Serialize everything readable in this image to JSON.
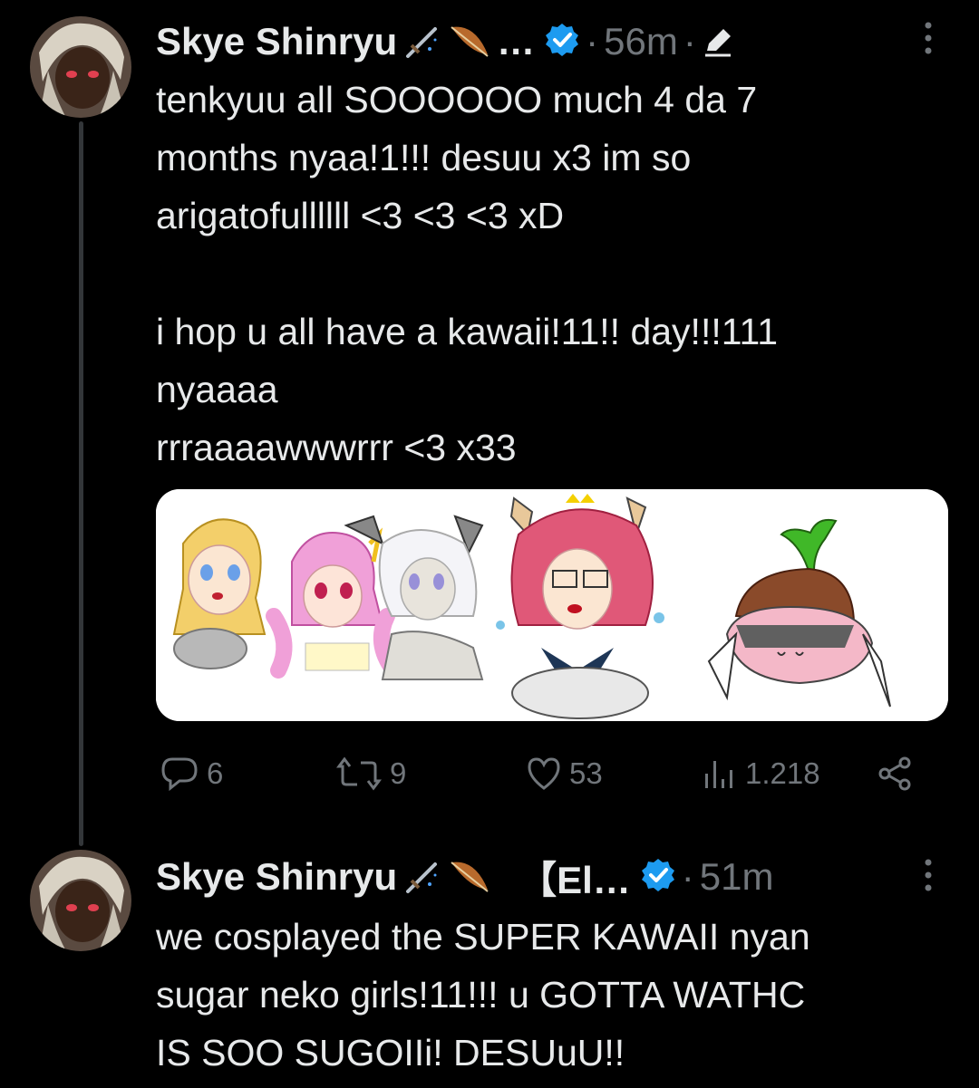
{
  "tweets": [
    {
      "author": "Skye Shinryu",
      "name_suffix": "…",
      "time": "56m",
      "body": "tenkyuu all SOOOOOO much 4 da 7\nmonths nyaa!1!!! desuu x3 im so\narigatofullllll <3 <3 <3 xD\n\ni hop u all have a kawaii!11!! day!!!111\nnyaaaa\nrrraaaawwwrrr <3 x33",
      "actions": {
        "replies": "6",
        "retweets": "9",
        "likes": "53",
        "views": "1.218"
      }
    },
    {
      "author": "Skye Shinryu",
      "name_suffix": "【El…",
      "time": "51m",
      "body": "we cosplayed the SUPER KAWAII nyan\nsugar neko girls!11!!! u GOTTA WATHC\nIS SOO SUGOIIi! DESUuU!!"
    }
  ],
  "separator": "·",
  "colors": {
    "background": "#000000",
    "text": "#e7e9ea",
    "secondary": "#71767b",
    "verified": "#1d9bf0"
  },
  "icons": [
    "dagger-emoji-icon",
    "feather-emoji-icon",
    "verified-badge-icon",
    "edited-pencil-icon",
    "more-options-icon",
    "reply-icon",
    "retweet-icon",
    "like-icon",
    "views-icon",
    "share-icon"
  ]
}
